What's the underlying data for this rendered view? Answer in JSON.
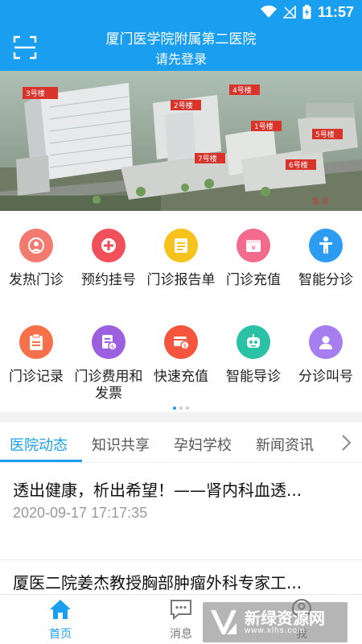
{
  "status_bar": {
    "time": "11:57",
    "icons": [
      "wifi-icon",
      "signal-off-icon",
      "battery-charging-icon"
    ]
  },
  "header": {
    "hospital_name": "厦门医学院附属第二医院",
    "login_hint": "请先登录",
    "scan_icon": "scan-icon"
  },
  "banner": {
    "building_labels": [
      "3号楼",
      "2号楼",
      "4号楼",
      "1号楼",
      "5号楼",
      "7号楼",
      "6号楼",
      "急 诊"
    ]
  },
  "services": [
    {
      "label": "发热门诊",
      "color": "#f27a6e",
      "icon": "fever-clinic-icon"
    },
    {
      "label": "预约挂号",
      "color": "#f0505a",
      "icon": "appointment-icon"
    },
    {
      "label": "门诊报告单",
      "color": "#f6c21b",
      "icon": "report-icon"
    },
    {
      "label": "门诊充值",
      "color": "#f36b8c",
      "icon": "recharge-icon"
    },
    {
      "label": "智能分诊",
      "color": "#2b9cf2",
      "icon": "smart-triage-icon"
    },
    {
      "label": "门诊记录",
      "color": "#f6704a",
      "icon": "record-icon"
    },
    {
      "label": "门诊费用和发票",
      "color": "#9b5fe0",
      "icon": "invoice-icon"
    },
    {
      "label": "快速充值",
      "color": "#f5553d",
      "icon": "quick-recharge-icon"
    },
    {
      "label": "智能导诊",
      "color": "#29c2a6",
      "icon": "robot-guide-icon"
    },
    {
      "label": "分诊叫号",
      "color": "#a77ef0",
      "icon": "queue-call-icon"
    }
  ],
  "pager": {
    "pages": 3,
    "current": 1
  },
  "tabs": [
    "医院动态",
    "知识共享",
    "孕妇学校",
    "新闻资讯"
  ],
  "news": [
    {
      "title": "透出健康，析出希望！——肾内科血透...",
      "time": "2020-09-17 17:17:35"
    },
    {
      "title": "厦医二院姜杰教授胸部肿瘤外科专家工..."
    }
  ],
  "bottom_nav": [
    {
      "label": "首页",
      "icon": "home-icon",
      "active": true
    },
    {
      "label": "消息",
      "icon": "message-icon",
      "active": false
    },
    {
      "label": "我",
      "icon": "profile-icon",
      "active": false
    }
  ],
  "watermark": {
    "text": "新绿资源网",
    "url": "www.xlhs.com"
  },
  "colors": {
    "primary": "#1a9ff0",
    "text": "#222222",
    "muted": "#999999"
  }
}
